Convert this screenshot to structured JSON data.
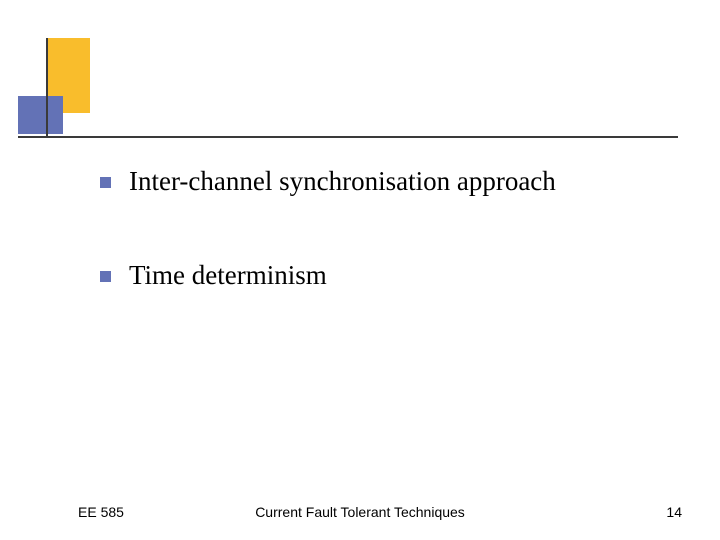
{
  "bullets": {
    "items": [
      {
        "text": "Inter-channel synchronisation approach"
      },
      {
        "text": "Time determinism"
      }
    ]
  },
  "footer": {
    "left": "EE 585",
    "center": "Current Fault Tolerant Techniques",
    "right": "14"
  }
}
